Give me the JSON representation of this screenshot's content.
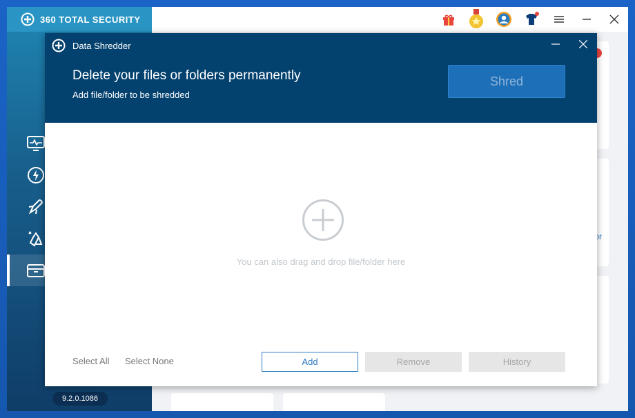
{
  "app": {
    "logo_text": "360 TOTAL SECURITY",
    "version": "9.2.0.1086",
    "side_nav": [
      "monitor-icon",
      "speedup-icon",
      "rocket-icon",
      "cleanup-icon",
      "toolbox-icon"
    ],
    "top_icons": [
      "gift-icon",
      "medal-icon",
      "user-icon",
      "tshirt-icon",
      "menu-icon",
      "minimize-icon",
      "close-icon"
    ],
    "bg_link_fragment": "or"
  },
  "dialog": {
    "title": "Data Shredder",
    "headline": "Delete your files or folders permanently",
    "subline": "Add file/folder to be shredded",
    "shred_label": "Shred",
    "drop_hint": "You can also drag and drop file/folder here",
    "select_all": "Select All",
    "select_none": "Select None",
    "add_label": "Add",
    "remove_label": "Remove",
    "history_label": "History"
  },
  "colors": {
    "header_bg": "#03416f",
    "accent": "#2a7ac2",
    "shred_bg": "#1d6fb8"
  }
}
